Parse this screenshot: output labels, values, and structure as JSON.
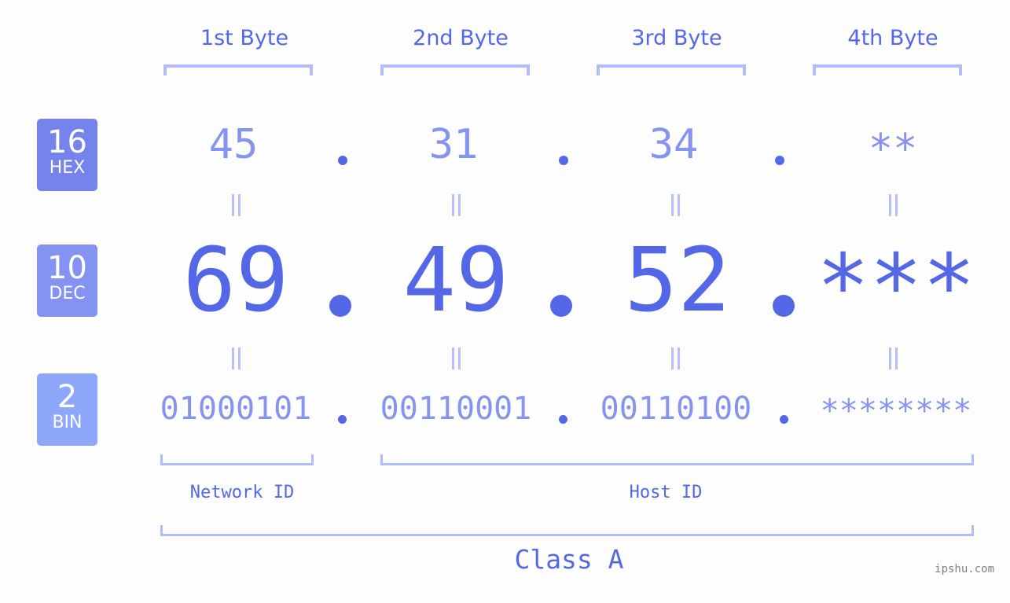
{
  "headers": [
    "1st Byte",
    "2nd Byte",
    "3rd Byte",
    "4th Byte"
  ],
  "bases": [
    {
      "number": "16",
      "label": "HEX",
      "color": "#7683ec"
    },
    {
      "number": "10",
      "label": "DEC",
      "color": "#8492f1"
    },
    {
      "number": "2",
      "label": "BIN",
      "color": "#8fa7fb"
    }
  ],
  "hex": [
    "45",
    "31",
    "34",
    "**"
  ],
  "dec": [
    "69",
    "49",
    "52",
    "***"
  ],
  "bin": [
    "01000101",
    "00110001",
    "00110100",
    "********"
  ],
  "separator": ".",
  "equals": "=",
  "sections": {
    "network": "Network ID",
    "host": "Host ID",
    "class": "Class A"
  },
  "watermark": "ipshu.com",
  "colors": {
    "accent": "#5468e7",
    "light_value": "#8794ee",
    "bracket": "#b2bcf8",
    "background": "#fcfdfc"
  }
}
